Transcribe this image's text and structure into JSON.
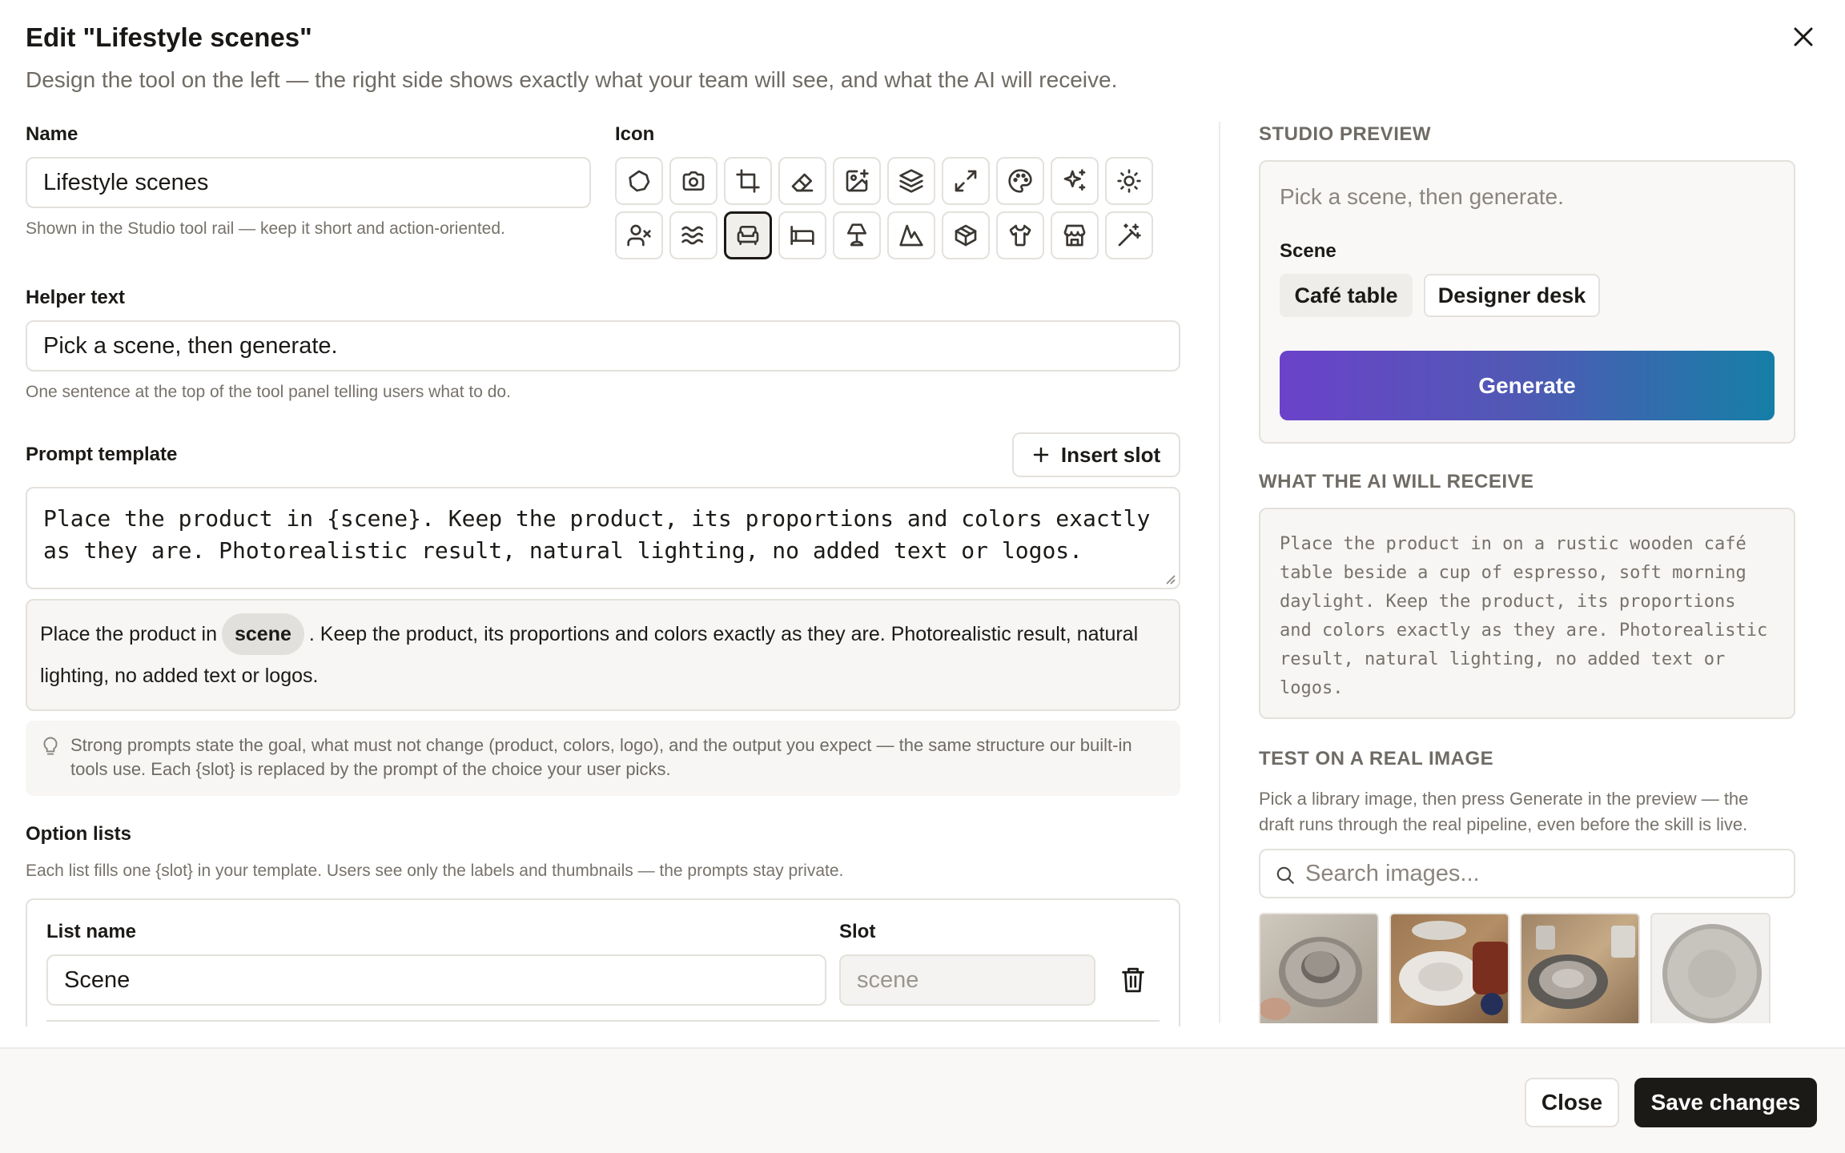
{
  "header": {
    "title": "Edit \"Lifestyle scenes\"",
    "subtitle": "Design the tool on the left — the right side shows exactly what your team will see, and what the AI will receive."
  },
  "name": {
    "label": "Name",
    "value": "Lifestyle scenes",
    "hint": "Shown in the Studio tool rail — keep it short and action-oriented."
  },
  "icon": {
    "label": "Icon",
    "selected": "armchair-icon",
    "options": [
      "circle-icon",
      "camera-icon",
      "crop-icon",
      "eraser-icon",
      "image-plus-icon",
      "layers-icon",
      "expand-icon",
      "palette-icon",
      "sparkles-icon",
      "sun-icon",
      "user-x-icon",
      "waves-icon",
      "armchair-icon",
      "bed-icon",
      "lamp-icon",
      "mountain-icon",
      "box-icon",
      "shirt-icon",
      "store-icon",
      "magic-wand-icon"
    ]
  },
  "helper": {
    "label": "Helper text",
    "value": "Pick a scene, then generate.",
    "hint": "One sentence at the top of the tool panel telling users what to do."
  },
  "prompt": {
    "label": "Prompt template",
    "insert_slot": "Insert slot",
    "template_line1": "Place the product in {scene}. Keep the product, its proportions and colors exactly",
    "template_line2": "as they are. Photorealistic result, natural lighting, no added text or logos.",
    "preview_before": "Place the product in",
    "preview_chip": "scene",
    "preview_after": ". Keep the product, its proportions and colors exactly as they are. Photorealistic result, natural lighting, no added text or logos.",
    "tip": "Strong prompts state the goal, what must not change (product, colors, logo), and the output you expect — the same structure our built-in tools use. Each {slot} is replaced by the prompt of the choice your user picks."
  },
  "option_lists": {
    "label": "Option lists",
    "hint": "Each list fills one {slot} in your template. Users see only the labels and thumbnails — the prompts stay private.",
    "list_name_label": "List name",
    "slot_label": "Slot",
    "list_name_value": "Scene",
    "slot_value": "scene"
  },
  "studio_preview": {
    "heading": "STUDIO PREVIEW",
    "helper": "Pick a scene, then generate.",
    "scene_label": "Scene",
    "options": [
      "Café table",
      "Designer desk"
    ],
    "generate": "Generate"
  },
  "ai_receive": {
    "heading": "WHAT THE AI WILL RECEIVE",
    "lines": [
      "Place the product in on a rustic wooden café",
      "table beside a cup of espresso, soft morning",
      "daylight. Keep the product, its proportions",
      "and colors exactly as they are. Photorealistic",
      "result, natural lighting, no added text or",
      "logos."
    ]
  },
  "test_image": {
    "heading": "TEST ON A REAL IMAGE",
    "hint_line1": "Pick a library image, then press Generate in the preview — the",
    "hint_line2": "draft runs through the real pipeline, even before the skill is live.",
    "search_placeholder": "Search images..."
  },
  "footer": {
    "close": "Close",
    "save": "Save changes"
  },
  "colors": {
    "generate_gradient_start": "#6b42c9",
    "generate_gradient_end": "#157fa6",
    "save_button": "#1c1a17"
  }
}
